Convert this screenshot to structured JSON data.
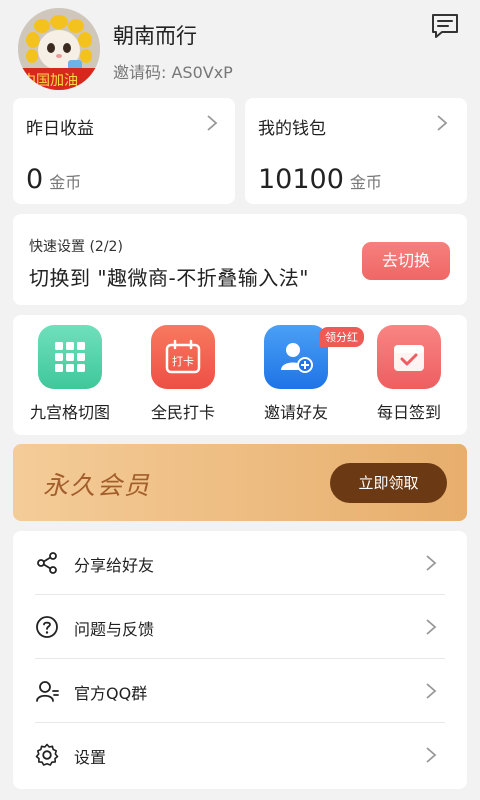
{
  "profile": {
    "name": "朝南而行",
    "invite_code": "邀请码: AS0VxP",
    "avatar_banner_text": "中国加油"
  },
  "stats": [
    {
      "title": "昨日收益",
      "value": "0",
      "unit": "金币"
    },
    {
      "title": "我的钱包",
      "value": "10100",
      "unit": "金币"
    }
  ],
  "quick_settings": {
    "label": "快速设置 (2/2)",
    "text": "切换到 \"趣微商-不折叠输入法\"",
    "button": "去切换"
  },
  "grid": [
    {
      "label": "九宫格切图",
      "icon": "grid-icon",
      "color": "#4fd5a9"
    },
    {
      "label": "全民打卡",
      "icon": "calendar-checkin-icon",
      "color": "#f05f4e",
      "icon_text": "打卡"
    },
    {
      "label": "邀请好友",
      "icon": "invite-friend-icon",
      "color": "#2f86f0",
      "badge": "领分红"
    },
    {
      "label": "每日签到",
      "icon": "daily-signin-icon",
      "color": "#f06a6a"
    }
  ],
  "vip": {
    "title": "永久会员",
    "button": "立即领取"
  },
  "menu": [
    {
      "label": "分享给好友",
      "icon": "share-icon"
    },
    {
      "label": "问题与反馈",
      "icon": "help-icon"
    },
    {
      "label": "官方QQ群",
      "icon": "user-group-icon"
    },
    {
      "label": "设置",
      "icon": "settings-icon"
    }
  ]
}
